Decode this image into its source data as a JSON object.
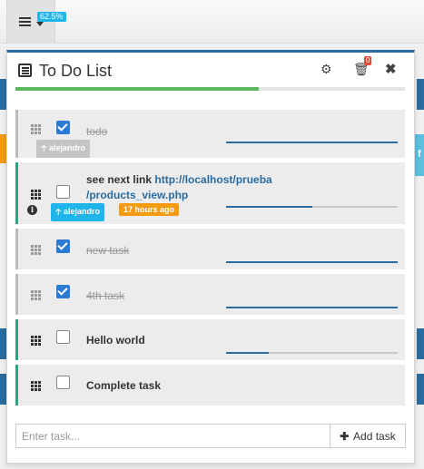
{
  "topbar": {
    "menu_icon": "list-icon",
    "progress_badge": "62.5%"
  },
  "todo": {
    "title": "To Do List",
    "settings_icon": "gear-icon",
    "trash_icon": "trash-icon",
    "trash_count": "0",
    "close_icon": "close-icon",
    "progress_fraction": 0.625,
    "accent_color": "#2a6ca0",
    "progress_color": "#5cb85c",
    "tasks": [
      {
        "text": "todo",
        "done": true,
        "user": "alejandro",
        "progress_fraction": 1.0
      },
      {
        "text": "see next link ",
        "link_line1": "http://localhost/prueba",
        "link_line2": "/products_view.php",
        "done": false,
        "user": "alejandro",
        "time": "17 hours ago",
        "progress_fraction": 0.5
      },
      {
        "text": "new task",
        "done": true,
        "progress_fraction": 1.0
      },
      {
        "text": "4th task",
        "done": true,
        "progress_fraction": 1.0
      },
      {
        "text": "Hello world",
        "done": false,
        "progress_fraction": 0.25
      },
      {
        "text": "Complete task",
        "done": false,
        "progress_fraction": 0.0
      }
    ],
    "input_placeholder": "Enter task...",
    "add_label": "Add task"
  },
  "side": {
    "right_tab_letter": "f"
  }
}
